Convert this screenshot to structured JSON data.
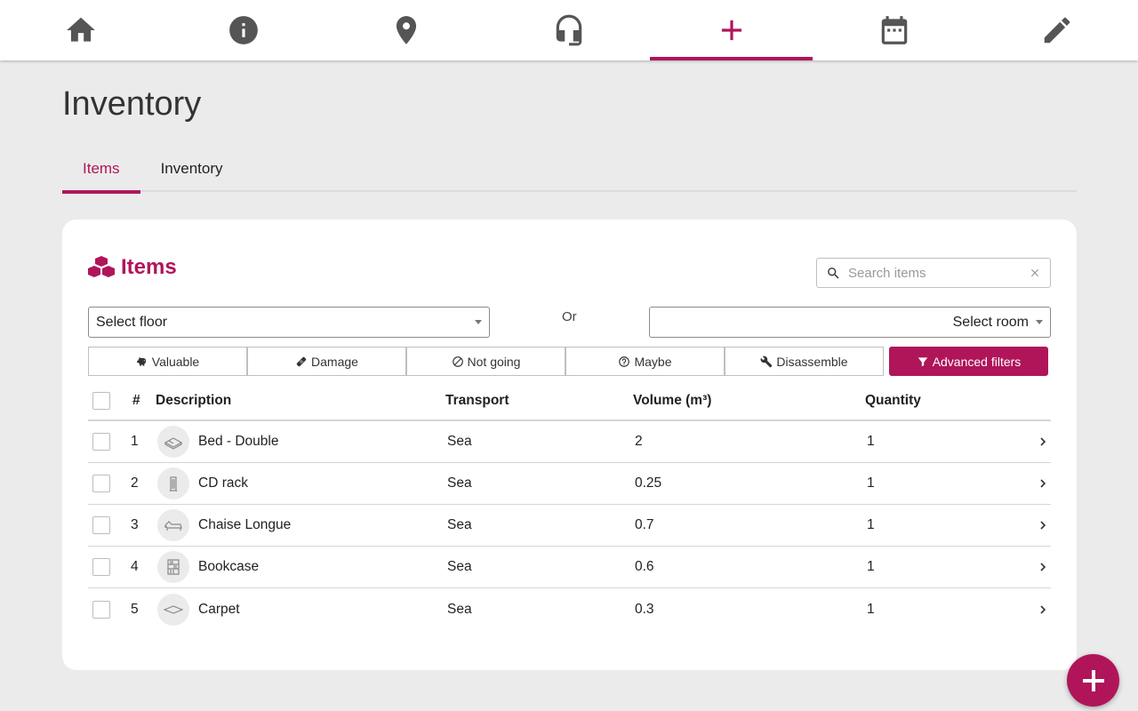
{
  "nav": {
    "items": [
      {
        "icon": "home-icon"
      },
      {
        "icon": "info-icon"
      },
      {
        "icon": "location-pin-icon"
      },
      {
        "icon": "headset-icon"
      },
      {
        "icon": "plus-icon",
        "active": true
      },
      {
        "icon": "calendar-icon"
      },
      {
        "icon": "pencil-icon"
      }
    ]
  },
  "page": {
    "title": "Inventory"
  },
  "tabs": [
    {
      "label": "Items",
      "active": true
    },
    {
      "label": "Inventory",
      "active": false
    }
  ],
  "card": {
    "title": "Items",
    "search": {
      "placeholder": "Search items",
      "value": ""
    },
    "floor_select": {
      "value": "Select floor"
    },
    "or_label": "Or",
    "room_select": {
      "value": "Select room"
    },
    "filters": {
      "valuable": "Valuable",
      "damage": "Damage",
      "not_going": "Not going",
      "maybe": "Maybe",
      "disassemble": "Disassemble",
      "advanced": "Advanced filters"
    },
    "table": {
      "headers": {
        "num": "#",
        "description": "Description",
        "transport": "Transport",
        "volume": "Volume (m³)",
        "quantity": "Quantity"
      },
      "rows": [
        {
          "num": "1",
          "description": "Bed - Double",
          "transport": "Sea",
          "volume": "2",
          "quantity": "1"
        },
        {
          "num": "2",
          "description": "CD rack",
          "transport": "Sea",
          "volume": "0.25",
          "quantity": "1"
        },
        {
          "num": "3",
          "description": "Chaise Longue",
          "transport": "Sea",
          "volume": "0.7",
          "quantity": "1"
        },
        {
          "num": "4",
          "description": "Bookcase",
          "transport": "Sea",
          "volume": "0.6",
          "quantity": "1"
        },
        {
          "num": "5",
          "description": "Carpet",
          "transport": "Sea",
          "volume": "0.3",
          "quantity": "1"
        }
      ]
    }
  },
  "colors": {
    "accent": "#b0155a",
    "background": "#ebebeb",
    "card": "#ffffff"
  }
}
